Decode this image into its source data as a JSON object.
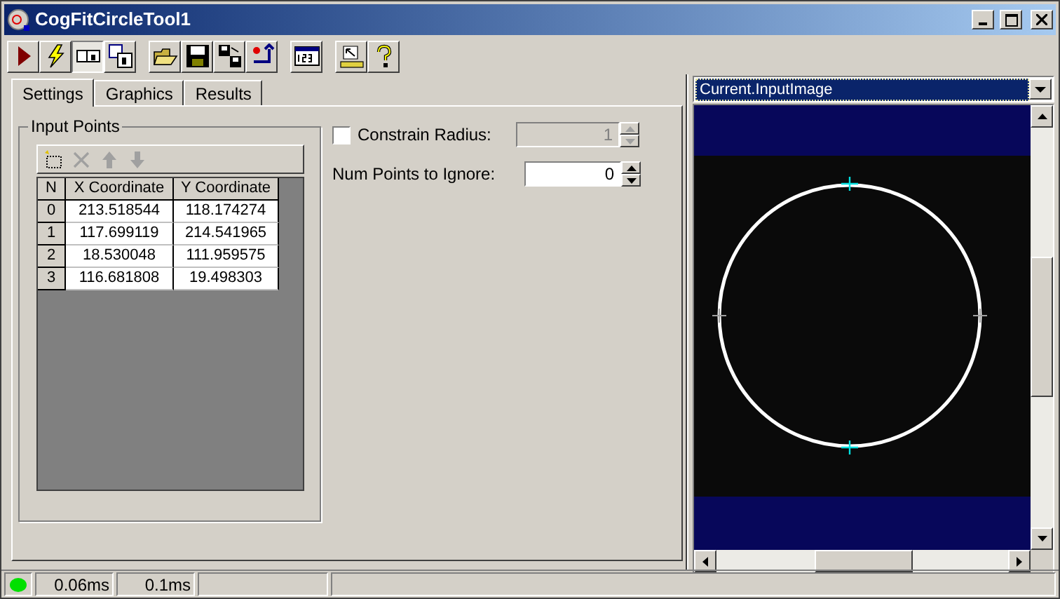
{
  "window": {
    "title": "CogFitCircleTool1"
  },
  "toolbar": [
    {
      "pressed": false
    },
    {
      "pressed": false
    },
    {
      "pressed": true
    },
    {
      "pressed": false
    },
    {
      "pressed": false
    },
    {
      "pressed": false
    },
    {
      "pressed": false
    },
    {
      "pressed": false
    },
    {
      "pressed": false
    },
    {
      "pressed": false
    },
    {
      "pressed": false
    }
  ],
  "tabs": [
    {
      "label": "Settings",
      "selected": true
    },
    {
      "label": "Graphics",
      "selected": false
    },
    {
      "label": "Results",
      "selected": false
    }
  ],
  "input_points": {
    "title": "Input Points",
    "list_tools": [
      {
        "disabled": false
      },
      {
        "disabled": true
      },
      {
        "disabled": true
      },
      {
        "disabled": true
      }
    ],
    "columns": [
      "N",
      "X Coordinate",
      "Y Coordinate"
    ],
    "rows": [
      [
        "0",
        "213.518544",
        "118.174274"
      ],
      [
        "1",
        "117.699119",
        "214.541965"
      ],
      [
        "2",
        "18.530048",
        "111.959575"
      ],
      [
        "3",
        "116.681808",
        "19.498303"
      ]
    ]
  },
  "constrain_radius": {
    "label": "Constrain Radius:",
    "checked": false,
    "value": "1",
    "disabled": true
  },
  "num_points_to_ignore": {
    "label": "Num Points to Ignore:",
    "value": "0",
    "disabled": false
  },
  "image_selector": {
    "value": "Current.InputImage"
  },
  "status_bar": {
    "times": [
      "0.06ms",
      "0.1ms"
    ]
  }
}
